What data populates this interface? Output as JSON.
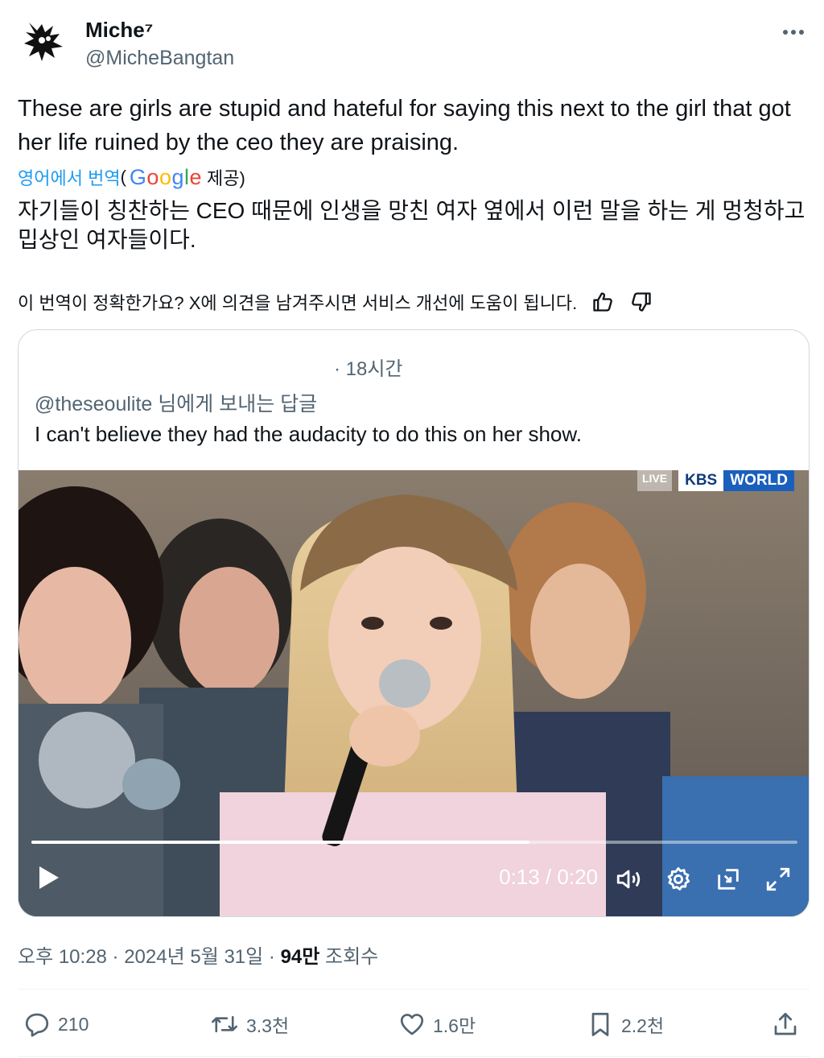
{
  "author": {
    "name": "Miche⁷",
    "handle": "@MicheBangtan"
  },
  "tweet": {
    "text": "These are girls are stupid and hateful for saying this next to the girl that got her life ruined by the ceo they are praising.",
    "translate_label": "영어에서 번역",
    "translate_open_paren": "(",
    "translate_provider_suffix": "제공)",
    "translated_text": "자기들이 칭찬하는 CEO 때문에 인생을 망친 여자 옆에서 이런 말을 하는 게 멍청하고 밉상인 여자들이다.",
    "feedback_prompt": "이 번역이 정확한가요? X에 의견을 남겨주시면 서비스 개선에 도움이 됩니다."
  },
  "quote": {
    "time": "· 18시간",
    "reply_to": "@theseoulite 님에게 보내는 답글",
    "text": "I can't believe they had the audacity to do this on her show.",
    "video": {
      "current_time": "0:13",
      "duration": "0:20",
      "time_display": "0:13 / 0:20",
      "progress": 0.65,
      "broadcaster_live": "LIVE",
      "broadcaster_kbs": "KBS",
      "broadcaster_world": "WORLD"
    }
  },
  "meta": {
    "time_date": "오후 10:28 · 2024년 5월 31일 · ",
    "views_count": "94만",
    "views_label": " 조회수"
  },
  "actions": {
    "replies": "210",
    "reposts": "3.3천",
    "likes": "1.6만",
    "bookmarks": "2.2천"
  },
  "colors": {
    "accent": "#1d9bf0",
    "text_primary": "#0f1419",
    "text_secondary": "#536471",
    "border": "#cfd9de"
  }
}
